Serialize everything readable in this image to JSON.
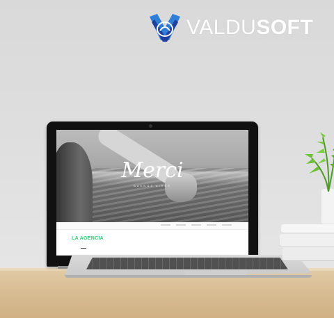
{
  "logo": {
    "text_light": "VALDU",
    "text_bold": "SOFT",
    "mark_colors": {
      "blue_dark": "#1f3f9c",
      "blue_light": "#2f7fd8"
    }
  },
  "laptop_screen": {
    "hero_title": "Merci",
    "hero_subtitle": "BUENOS AIRES",
    "section_title": "LA AGENCIA",
    "accent_color": "#2ecc71"
  }
}
